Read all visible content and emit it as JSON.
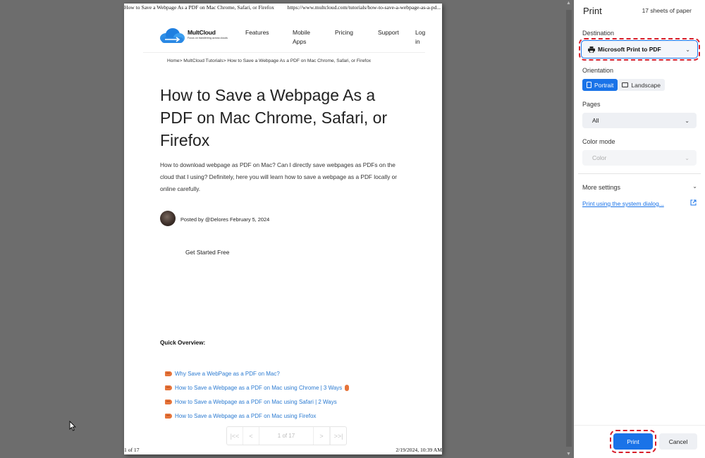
{
  "preview": {
    "header_title": "How to Save a Webpage As a PDF on Mac Chrome, Safari, or Firefox",
    "header_url": "https://www.multcloud.com/tutorials/how-to-save-a-webpage-as-a-pd...",
    "footer_page": "1 of 17",
    "footer_date": "2/19/2024, 10:39 AM",
    "site": {
      "logo_name": "MultCloud",
      "logo_tagline": "Focus on transferring across clouds",
      "nav": {
        "features": "Features",
        "mobile_apps": "Mobile Apps",
        "pricing": "Pricing",
        "support": "Support",
        "login": "Log in"
      }
    },
    "breadcrumb": "Home> MultCloud Tutorials> How to Save a Webpage As a PDF on Mac Chrome, Safari, or Firefox",
    "article_title": "How to Save a Webpage As a PDF on Mac Chrome, Safari, or Firefox",
    "article_intro": "How to download webpage as PDF on Mac? Can I directly save webpages as PDFs on the cloud that I using? Definitely, here you will learn how to save a webpage as a PDF locally or online carefully.",
    "author_line": "Posted by @Delores February 5, 2024",
    "cta": "Get Started Free",
    "overview_heading": "Quick Overview:",
    "toc": [
      "Why Save a WebPage as a PDF on Mac?",
      "How to Save a Webpage as a PDF on Mac using Chrome | 3 Ways",
      "How to Save a Webpage as a PDF on Mac using Safari | 2 Ways",
      "How to Save a Webpage as a PDF on Mac using Firefox"
    ],
    "page_nav": {
      "first": "|<<",
      "prev": "<",
      "position": "1 of 17",
      "next": ">",
      "last": ">>|"
    }
  },
  "panel": {
    "title": "Print",
    "sheets": "17 sheets of paper",
    "destination_label": "Destination",
    "destination_value": "Microsoft Print to PDF",
    "orientation_label": "Orientation",
    "portrait": "Portrait",
    "landscape": "Landscape",
    "pages_label": "Pages",
    "pages_value": "All",
    "color_label": "Color mode",
    "color_value": "Color",
    "more_settings": "More settings",
    "system_dialog": "Print using the system dialog...",
    "print_button": "Print",
    "cancel_button": "Cancel"
  },
  "colors": {
    "accent": "#1a73e8",
    "highlight_dash": "#d81e2a",
    "preview_background": "#6d6d6d",
    "link": "#2c7bd1"
  },
  "icons": {
    "printer": "printer-icon",
    "external": "open-external-icon",
    "chevron": "chevron-down-icon",
    "cursor": "mouse-pointer-icon"
  }
}
